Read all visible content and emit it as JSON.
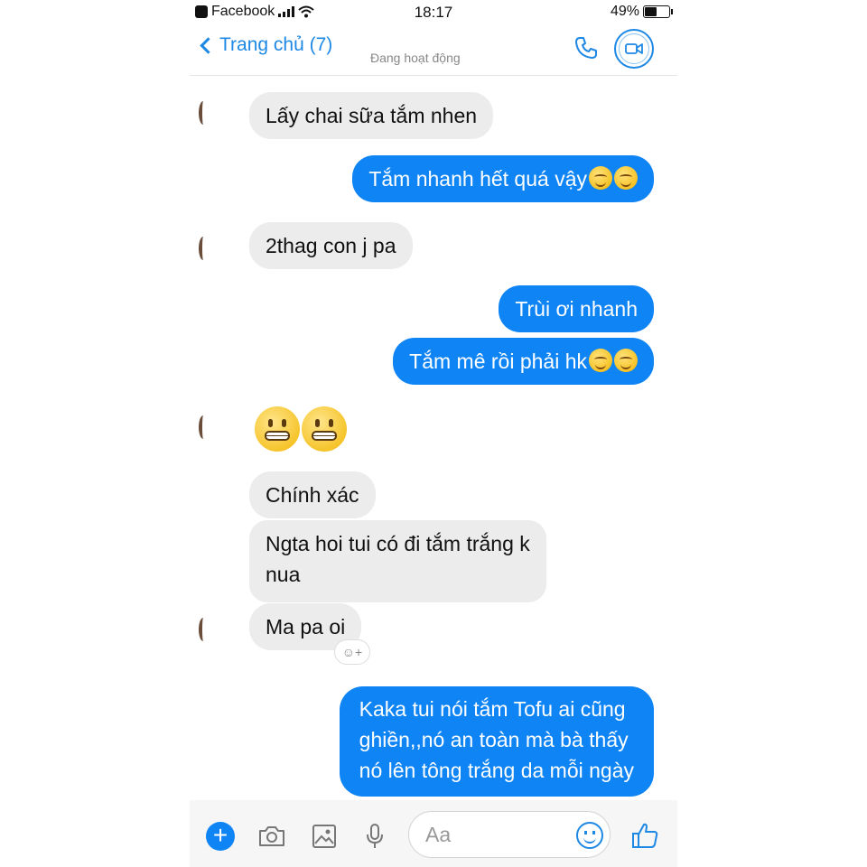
{
  "status_bar": {
    "app_back": "Facebook",
    "time": "18:17",
    "battery": "49%",
    "battery_level": 0.49
  },
  "header": {
    "back_label": "Trang chủ (7)",
    "active_status": "Đang hoạt động"
  },
  "messages": [
    {
      "side": "in",
      "text": "Lấy chai sữa tắm nhen"
    },
    {
      "side": "out",
      "text": "Tắm nhanh hết quá vậy",
      "emoji_count": 2
    },
    {
      "side": "in",
      "text": "2thag con j pa"
    },
    {
      "side": "out",
      "text": "Trùi ơi nhanh"
    },
    {
      "side": "out",
      "text": "Tắm mê rồi phải hk",
      "emoji_count": 2
    },
    {
      "side": "in",
      "emoji": "grimacing-face",
      "emoji_count": 2
    },
    {
      "side": "in",
      "text": "Chính xác"
    },
    {
      "side": "in",
      "lines": [
        "Ngta hoi tui có đi tắm trắng k",
        "nua"
      ]
    },
    {
      "side": "in",
      "text": "Ma pa oi"
    },
    {
      "side": "out",
      "lines": [
        "Kaka tui nói tắm Tofu ai cũng",
        "ghiền,,nó an toàn mà bà thấy",
        "nó lên tông trắng da mỗi ngày"
      ]
    }
  ],
  "composer": {
    "placeholder": "Aa",
    "icons": [
      "plus-icon",
      "camera-icon",
      "image-icon",
      "microphone-icon",
      "emoji-icon",
      "like-icon"
    ]
  },
  "colors": {
    "accent": "#1e88e5",
    "outgoing_bubble": "#0f84f5",
    "incoming_bubble": "#ececec"
  }
}
